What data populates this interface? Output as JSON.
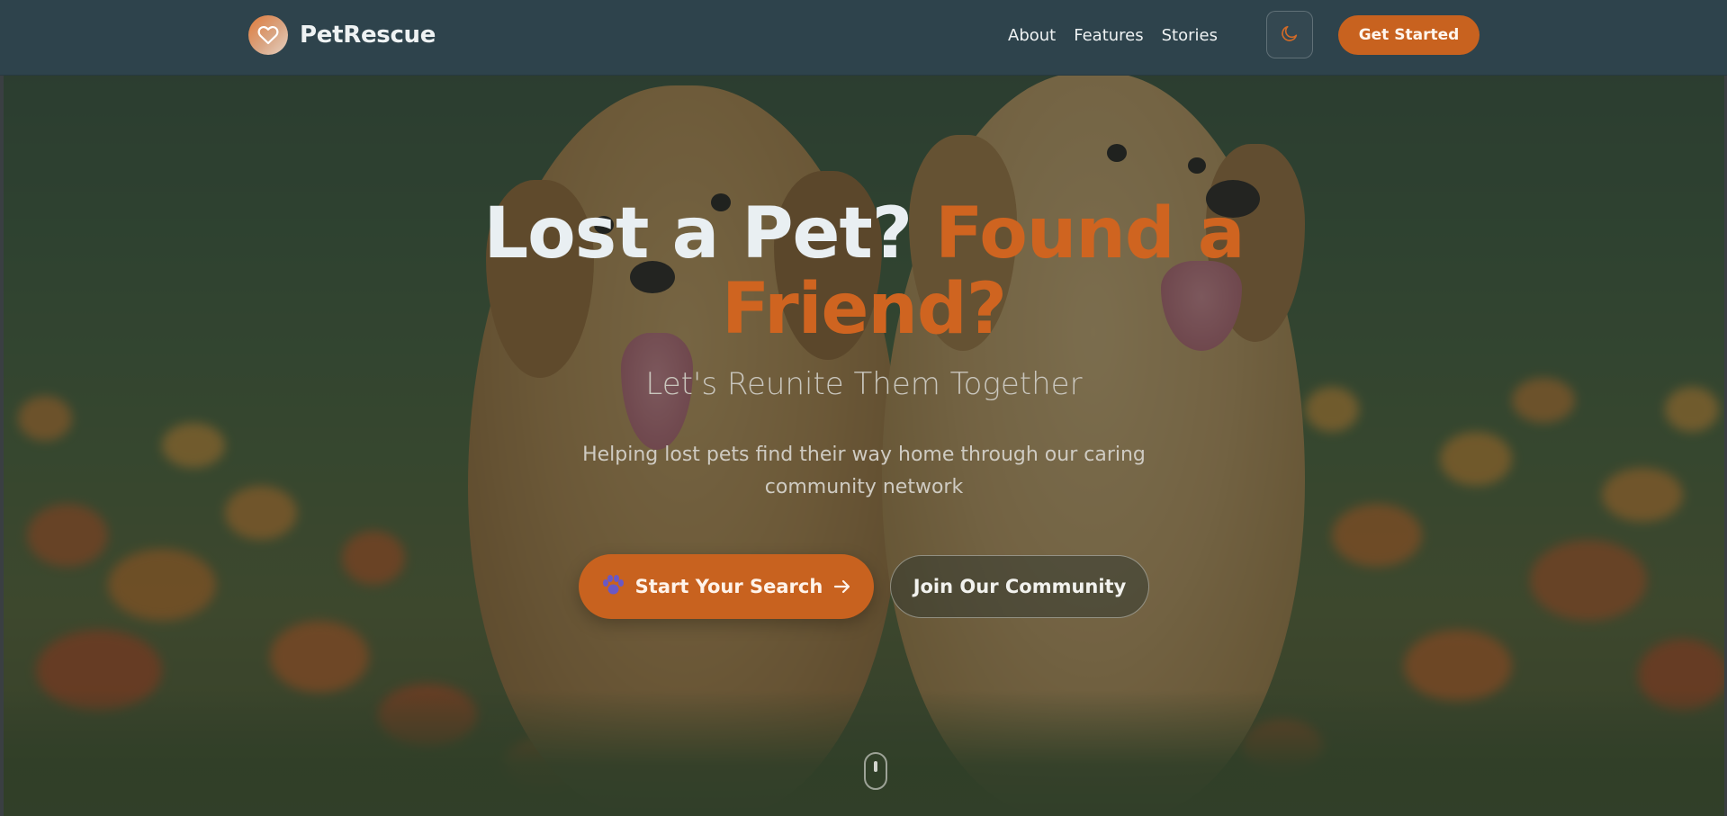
{
  "navbar": {
    "brand_name": "PetRescue",
    "brand_icon": "heart-icon",
    "links": [
      {
        "label": "About"
      },
      {
        "label": "Features"
      },
      {
        "label": "Stories"
      }
    ],
    "theme_toggle_icon": "moon-icon",
    "cta_label": "Get Started"
  },
  "hero": {
    "title_part1": "Lost a Pet?",
    "title_part2": "Found a",
    "title_part3": "Friend?",
    "subtitle": "Let's Reunite Them Together",
    "description": "Helping lost pets find their way home through our caring community network",
    "primary_button": {
      "label": "Start Your Search",
      "icon_left": "paw-icon",
      "icon_right": "arrow-right-icon"
    },
    "secondary_button": {
      "label": "Join Our Community"
    },
    "scroll_icon": "mouse-scroll-icon"
  },
  "colors": {
    "navbar_bg": "#2e434c",
    "accent": "#c8621f",
    "title_white": "#e9eff2",
    "title_orange": "#cf6420"
  }
}
